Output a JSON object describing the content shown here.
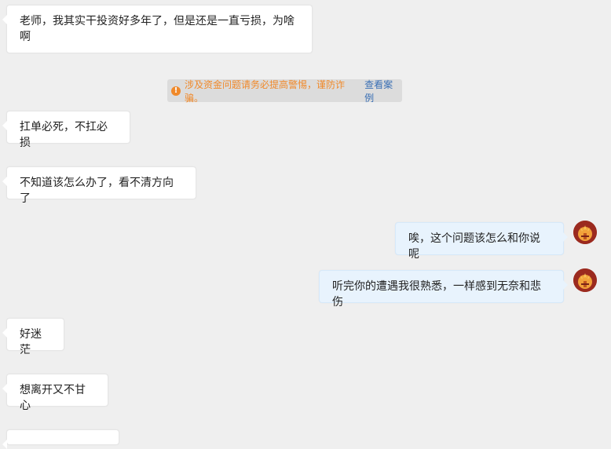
{
  "notice": {
    "warning": "涉及资金问题请务必提高警惕，谨防诈骗。",
    "link": "查看案例",
    "icon": "alert-icon"
  },
  "messages": [
    {
      "side": "left",
      "text": "老师，我其实干投资好多年了，但是还是一直亏损，为啥啊"
    },
    {
      "side": "left",
      "text": "扛单必死，不扛必损"
    },
    {
      "side": "left",
      "text": "不知道该怎么办了，看不清方向了"
    },
    {
      "side": "right",
      "text": "唉，这个问题该怎么和你说呢"
    },
    {
      "side": "right",
      "text": "听完你的遭遇我很熟悉，一样感到无奈和悲伤"
    },
    {
      "side": "left",
      "text": "好迷茫"
    },
    {
      "side": "left",
      "text": "想离开又不甘心"
    }
  ],
  "colors": {
    "background": "#efefef",
    "left_bubble": "#ffffff",
    "right_bubble": "#e8f3fd",
    "notice_text": "#f0892a",
    "notice_link": "#3a6fb4"
  },
  "avatar_icon": "wheat-avatar-icon"
}
